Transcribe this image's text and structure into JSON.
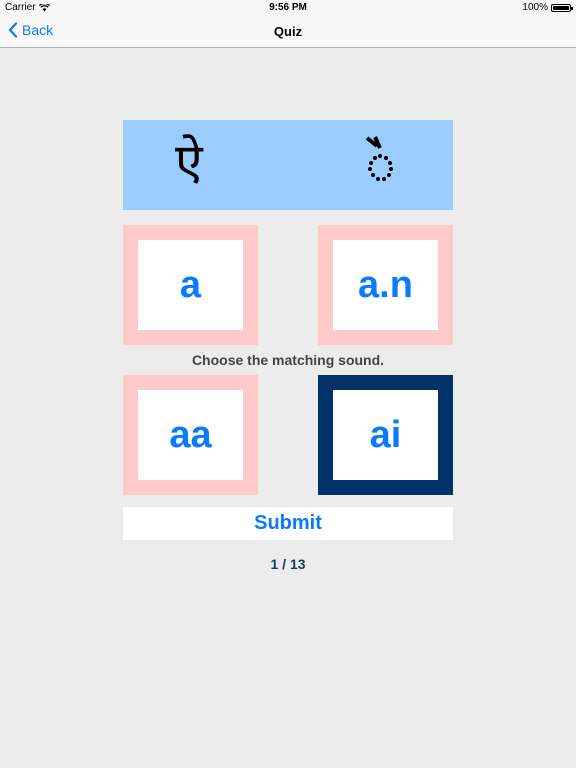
{
  "status_bar": {
    "carrier": "Carrier",
    "time": "9:56 PM",
    "battery": "100%"
  },
  "nav": {
    "back_label": "Back",
    "title": "Quiz"
  },
  "prompt": {
    "glyph_left": "ऐ"
  },
  "choices": [
    {
      "label": "a"
    },
    {
      "label": "a.n"
    },
    {
      "label": "aa"
    },
    {
      "label": "ai"
    }
  ],
  "instruction": "Choose the matching sound.",
  "submit_label": "Submit",
  "progress": "1 / 13",
  "colors": {
    "accent": "#0a7aff",
    "prompt_bg": "#9ccbfe",
    "choice_bg": "#ffcaca",
    "selected_bg": "#003369",
    "page_bg": "#ececec"
  }
}
